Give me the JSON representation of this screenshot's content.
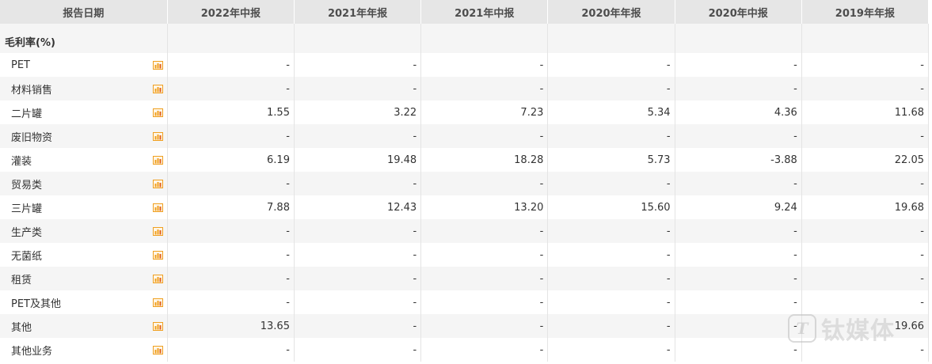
{
  "header": {
    "date_label": "报告日期",
    "periods": [
      "2022年中报",
      "2021年年报",
      "2021年中报",
      "2020年年报",
      "2020年中报",
      "2019年年报"
    ]
  },
  "section": {
    "title": "毛利率(%)"
  },
  "rows": [
    {
      "label": "PET",
      "values": [
        "-",
        "-",
        "-",
        "-",
        "-",
        "-"
      ]
    },
    {
      "label": "材料销售",
      "values": [
        "-",
        "-",
        "-",
        "-",
        "-",
        "-"
      ]
    },
    {
      "label": "二片罐",
      "values": [
        "1.55",
        "3.22",
        "7.23",
        "5.34",
        "4.36",
        "11.68"
      ]
    },
    {
      "label": "废旧物资",
      "values": [
        "-",
        "-",
        "-",
        "-",
        "-",
        "-"
      ]
    },
    {
      "label": "灌装",
      "values": [
        "6.19",
        "19.48",
        "18.28",
        "5.73",
        "-3.88",
        "22.05"
      ]
    },
    {
      "label": "贸易类",
      "values": [
        "-",
        "-",
        "-",
        "-",
        "-",
        "-"
      ]
    },
    {
      "label": "三片罐",
      "values": [
        "7.88",
        "12.43",
        "13.20",
        "15.60",
        "9.24",
        "19.68"
      ]
    },
    {
      "label": "生产类",
      "values": [
        "-",
        "-",
        "-",
        "-",
        "-",
        "-"
      ]
    },
    {
      "label": "无菌纸",
      "values": [
        "-",
        "-",
        "-",
        "-",
        "-",
        "-"
      ]
    },
    {
      "label": "租赁",
      "values": [
        "-",
        "-",
        "-",
        "-",
        "-",
        "-"
      ]
    },
    {
      "label": "PET及其他",
      "values": [
        "-",
        "-",
        "-",
        "-",
        "-",
        "-"
      ]
    },
    {
      "label": "其他",
      "values": [
        "13.65",
        "-",
        "-",
        "-",
        "-",
        "19.66"
      ]
    },
    {
      "label": "其他业务",
      "values": [
        "-",
        "-",
        "-",
        "-",
        "-",
        "-"
      ]
    }
  ],
  "row_icon": "bar-chart-icon",
  "colors": {
    "header_bg": "#e6e6e6",
    "stripe_bg": "#f5f5f5",
    "icon_orange": "#f0a020"
  },
  "watermark": {
    "text": "钛媒体",
    "logo": "T"
  }
}
